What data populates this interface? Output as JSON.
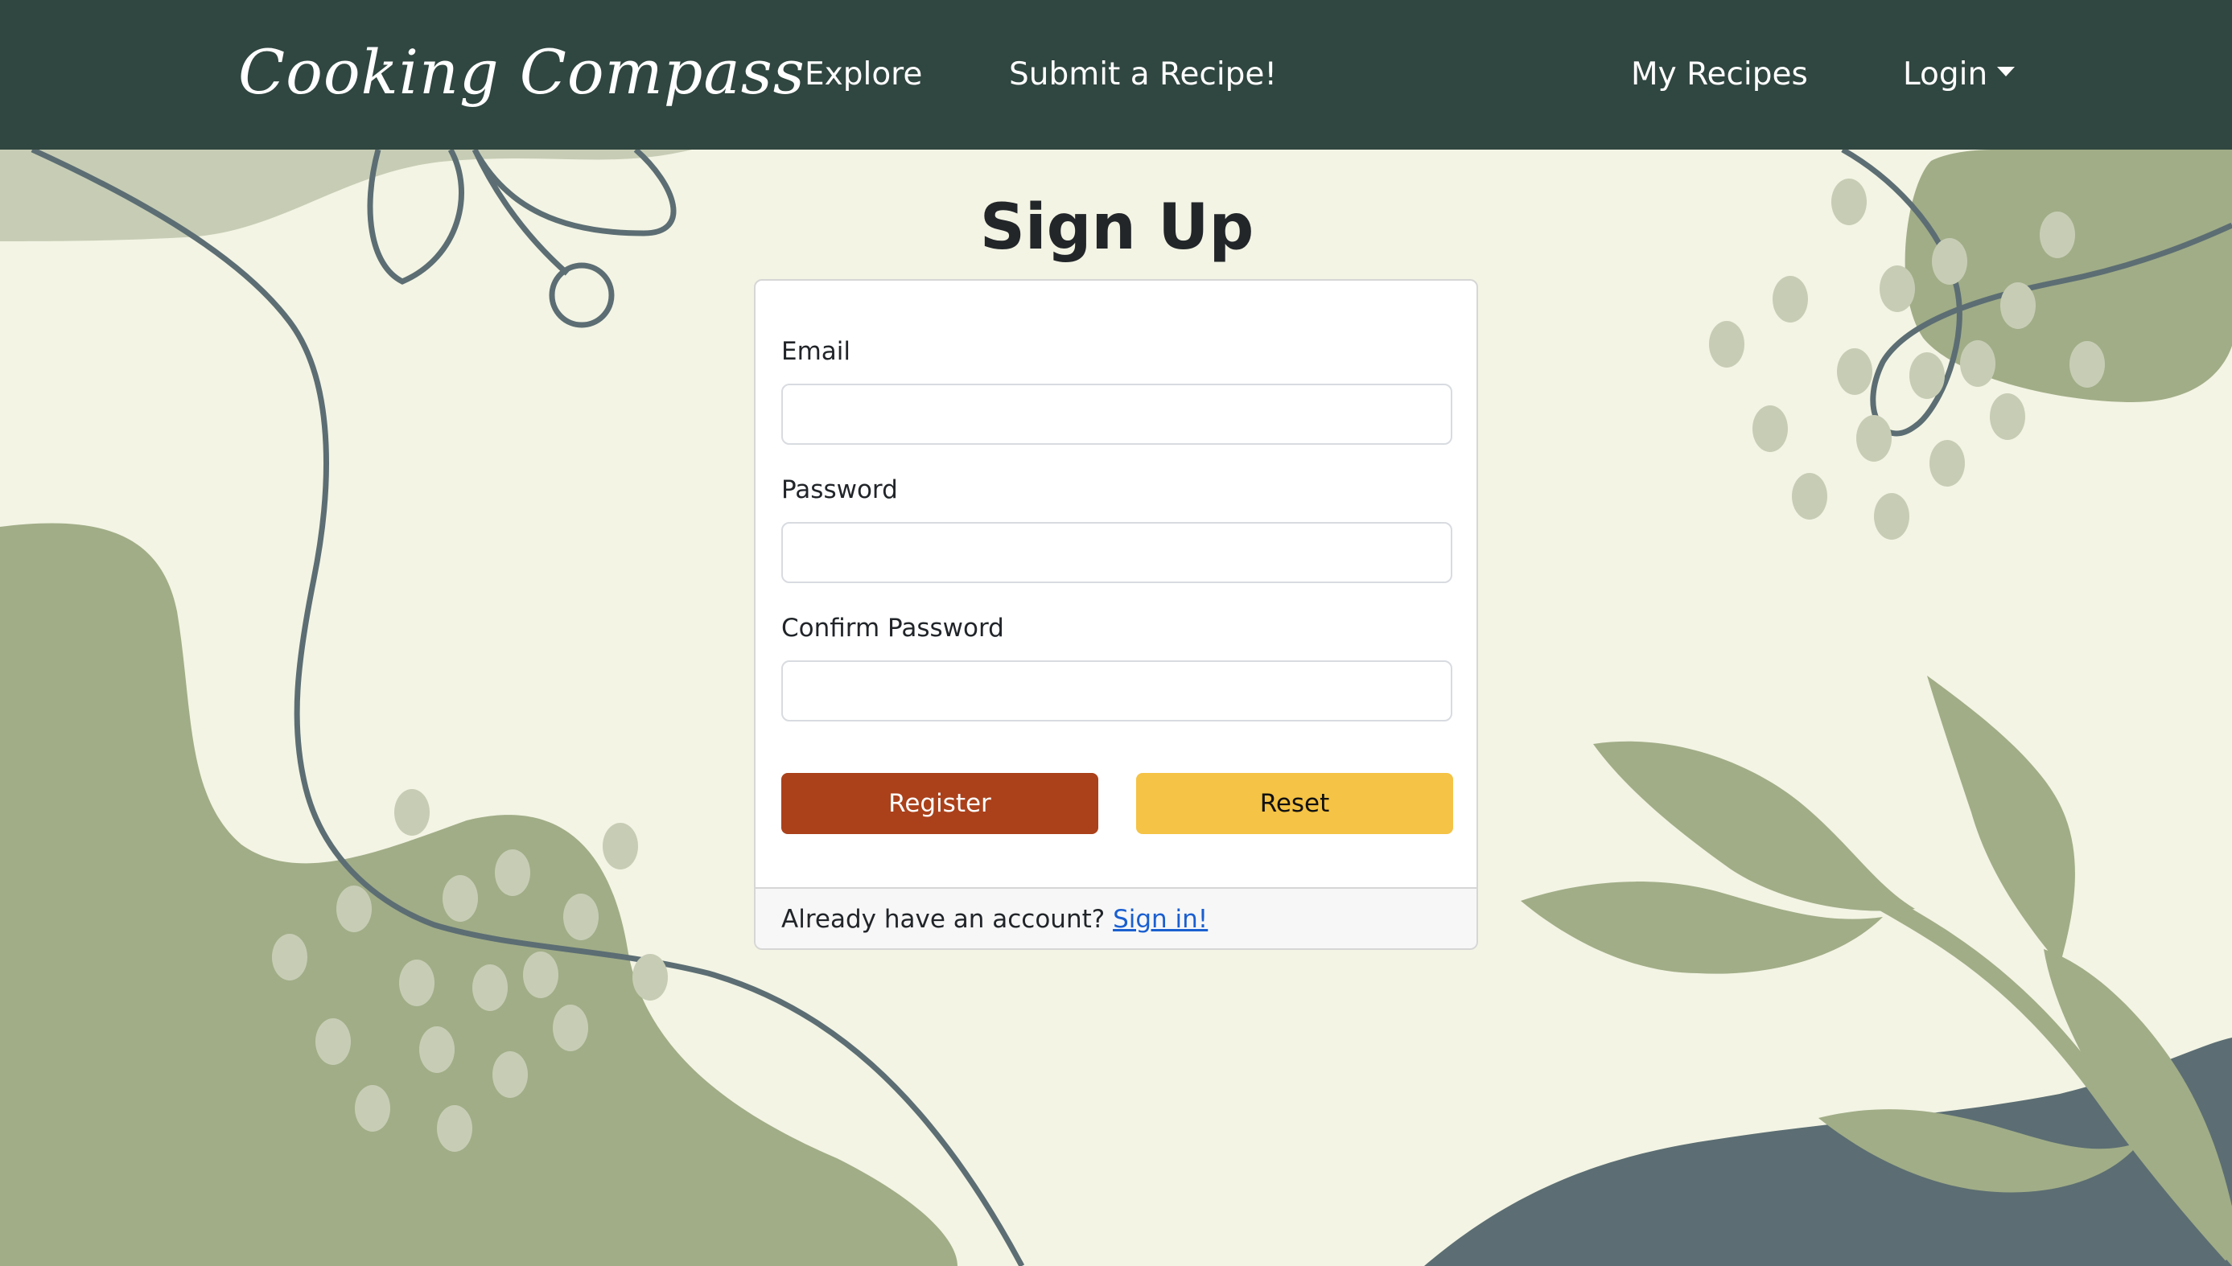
{
  "navbar": {
    "brand": "Cooking Compass",
    "links": {
      "explore": "Explore",
      "submit": "Submit a Recipe!",
      "my_recipes": "My Recipes",
      "login": "Login"
    }
  },
  "page_title": "Sign Up",
  "form": {
    "email_label": "Email",
    "email_value": "",
    "password_label": "Password",
    "password_value": "",
    "confirm_label": "Confirm Password",
    "confirm_value": "",
    "register_label": "Register",
    "reset_label": "Reset"
  },
  "footer": {
    "prompt": "Already have an account?",
    "signin_link": "Sign in!"
  },
  "colors": {
    "navbar": "#304640",
    "background": "#f3f4e4",
    "sage": "#a1ad87",
    "slate": "#5c6e73",
    "register": "#aa411b",
    "reset": "#f5c345",
    "link": "#1a5fd0"
  }
}
